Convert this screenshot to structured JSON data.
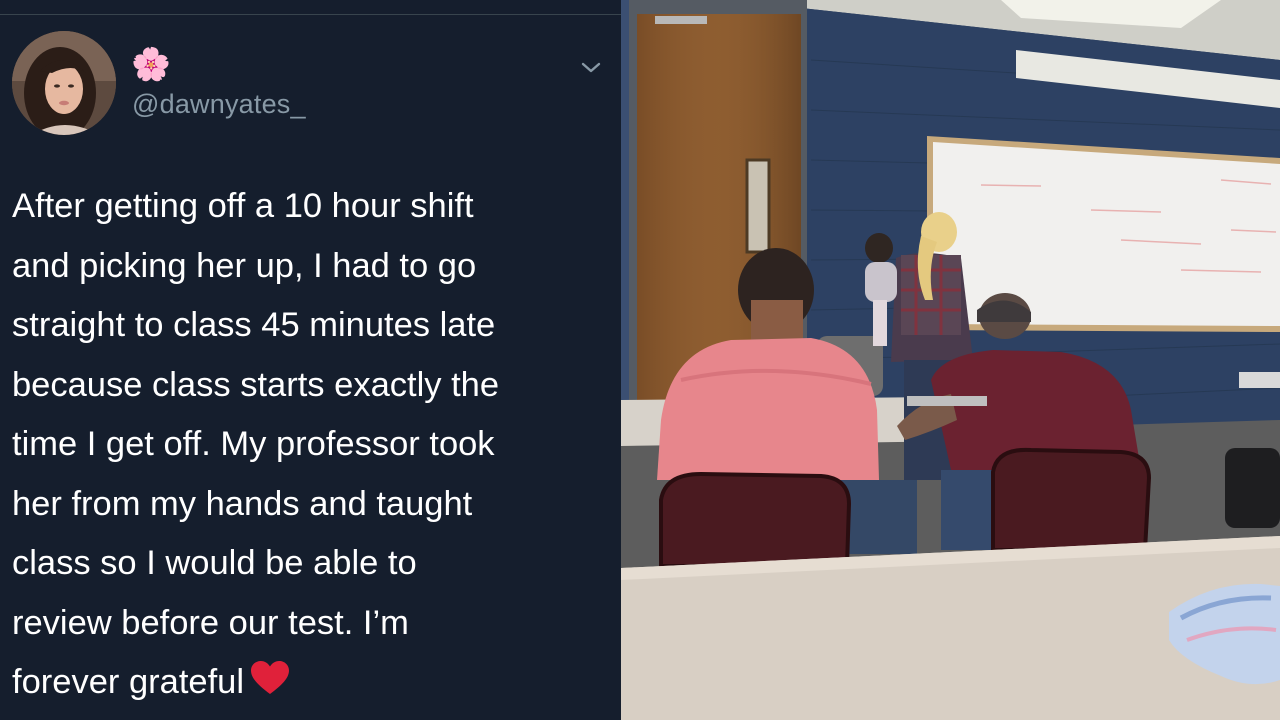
{
  "tweet": {
    "display_name": "🌸",
    "handle": "@dawnyates_",
    "lines": [
      "After getting off a 10 hour shift",
      "and picking her up, I had to go",
      "straight to class 45 minutes late",
      "because class starts exactly the",
      "time I get off. My professor took",
      "her from my hands and taught",
      "class so I would be able to",
      "review before our test. I’m",
      "forever grateful"
    ],
    "icons": {
      "avatar": "profile-photo",
      "menu": "chevron-down-icon",
      "end_emoji": "red-heart-icon"
    }
  },
  "colors": {
    "background": "#151e2d",
    "text": "#ffffff",
    "muted": "#8899a6",
    "heart": "#e0213a"
  }
}
